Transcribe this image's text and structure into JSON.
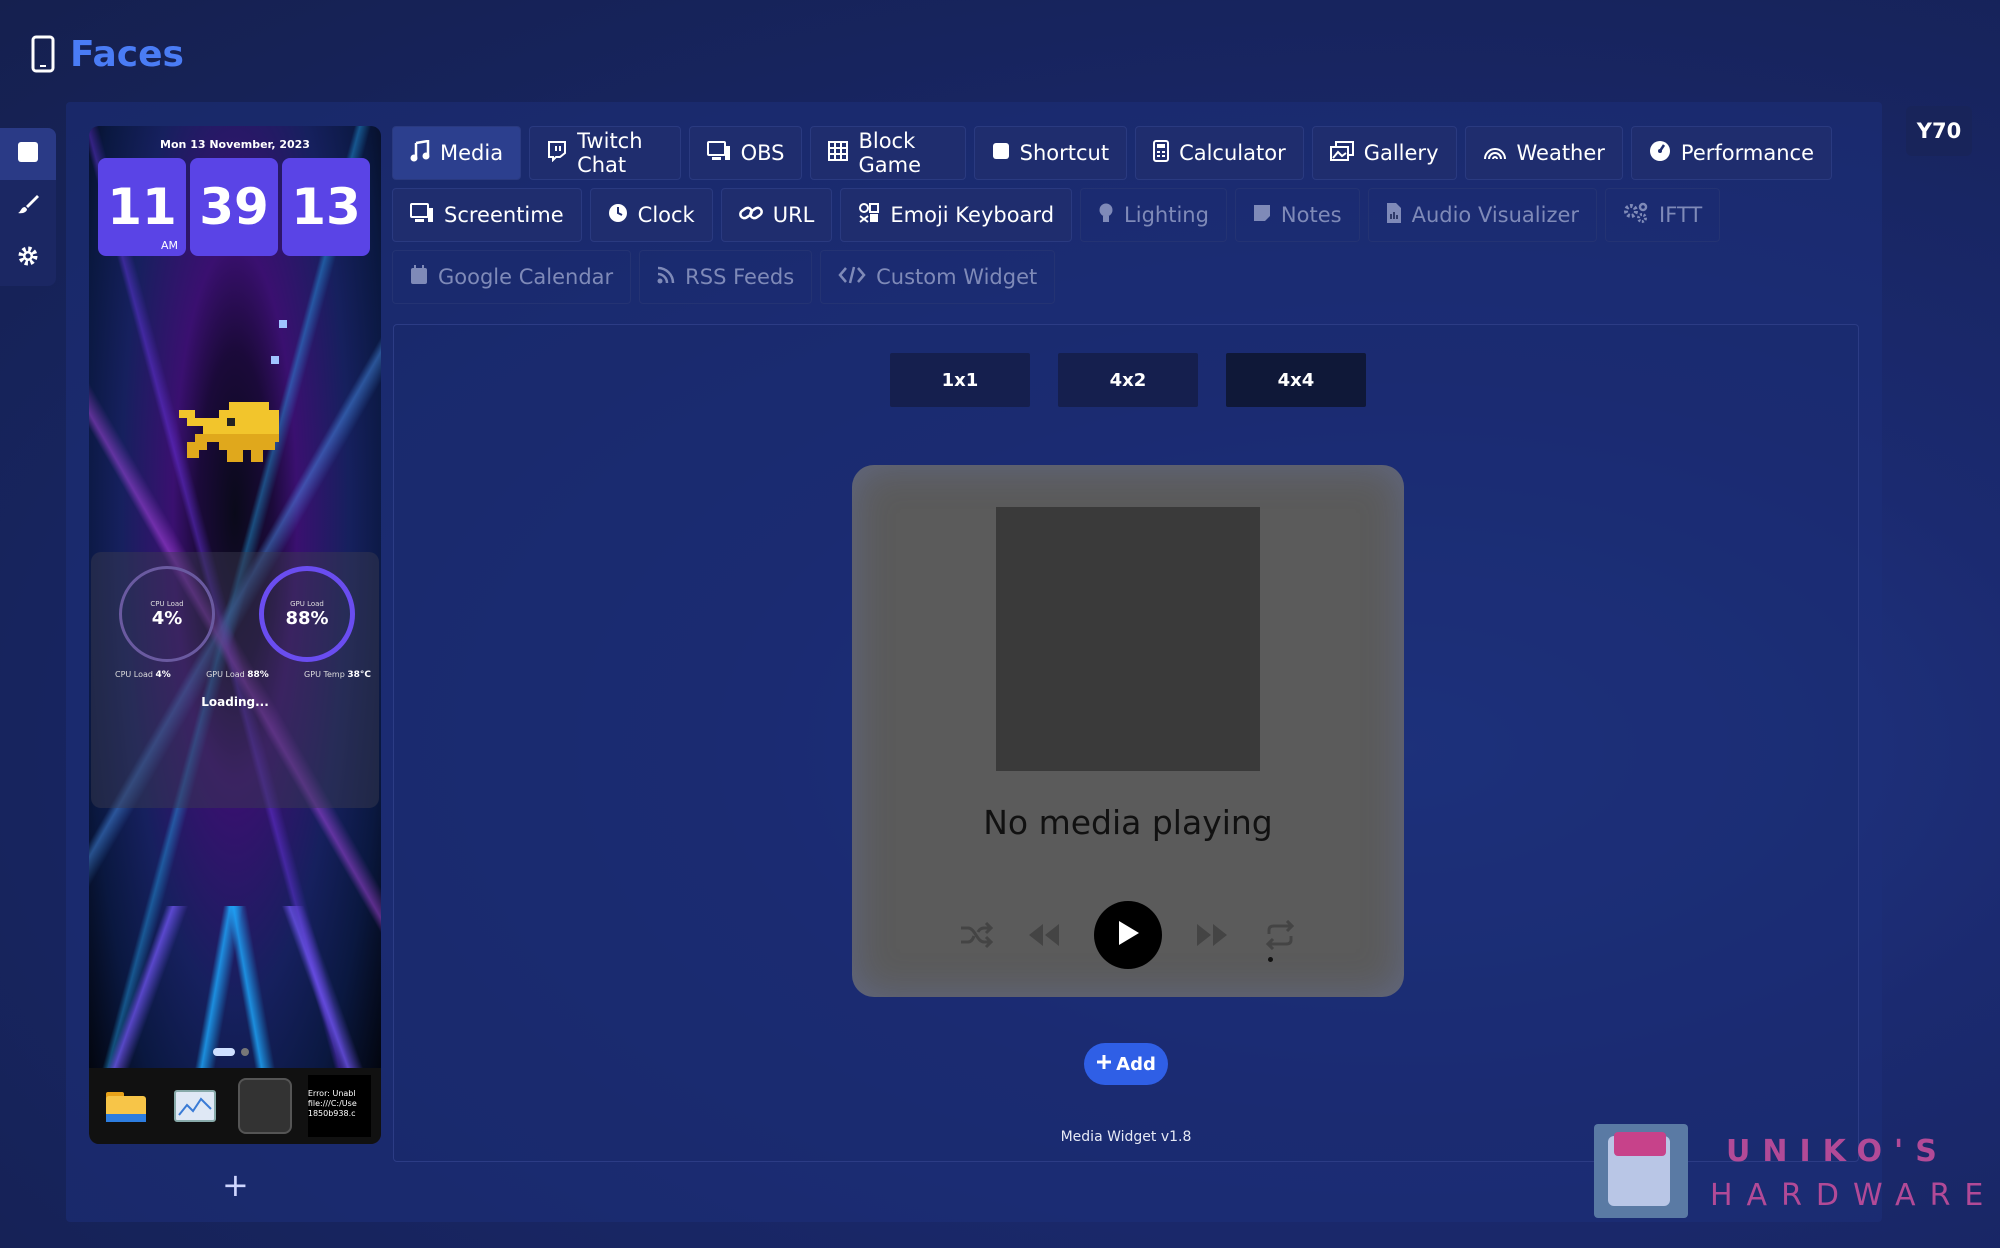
{
  "app": {
    "title": "Faces",
    "device": "Y70"
  },
  "side_tools": [
    {
      "name": "square-tool",
      "icon": "square-icon"
    },
    {
      "name": "brush-tool",
      "icon": "brush-icon"
    },
    {
      "name": "settings-tool",
      "icon": "gear-icon"
    }
  ],
  "preview": {
    "date": "Mon 13 November, 2023",
    "time": {
      "hour": "11",
      "minute": "39",
      "second": "13",
      "ampm": "AM"
    },
    "gauges": [
      {
        "label": "CPU Load",
        "value": "4%"
      },
      {
        "label": "GPU Load",
        "value": "88%"
      }
    ],
    "stats": [
      {
        "label": "CPU Load",
        "value": "4%"
      },
      {
        "label": "GPU Load",
        "value": "88%"
      },
      {
        "label": "GPU Temp",
        "value": "38°C"
      }
    ],
    "loading": "Loading...",
    "dock_error": "Error: Unabl file:///C:/Use 1850b938.c",
    "add_label": "+"
  },
  "tabs": {
    "row1": [
      {
        "label": "Media",
        "icon": "music-icon",
        "state": "active"
      },
      {
        "label": "Twitch Chat",
        "icon": "twitch-icon",
        "state": "enabled"
      },
      {
        "label": "OBS",
        "icon": "monitor-icon",
        "state": "enabled"
      },
      {
        "label": "Block Game",
        "icon": "grid-icon",
        "state": "enabled"
      },
      {
        "label": "Shortcut",
        "icon": "square-icon",
        "state": "enabled"
      },
      {
        "label": "Calculator",
        "icon": "calculator-icon",
        "state": "enabled"
      },
      {
        "label": "Gallery",
        "icon": "images-icon",
        "state": "enabled"
      },
      {
        "label": "Weather",
        "icon": "rainbow-icon",
        "state": "enabled"
      },
      {
        "label": "Performance",
        "icon": "gauge-icon",
        "state": "enabled"
      }
    ],
    "row2": [
      {
        "label": "Screentime",
        "icon": "monitor-icon",
        "state": "enabled"
      },
      {
        "label": "Clock",
        "icon": "clock-icon",
        "state": "enabled"
      },
      {
        "label": "URL",
        "icon": "link-icon",
        "state": "enabled"
      },
      {
        "label": "Emoji Keyboard",
        "icon": "emoji-icon",
        "state": "enabled"
      },
      {
        "label": "Lighting",
        "icon": "bulb-icon",
        "state": "disabled"
      },
      {
        "label": "Notes",
        "icon": "note-icon",
        "state": "disabled"
      },
      {
        "label": "Audio Visualizer",
        "icon": "audio-file-icon",
        "state": "disabled"
      },
      {
        "label": "IFTT",
        "icon": "gears-icon",
        "state": "disabled"
      }
    ],
    "row3": [
      {
        "label": "Google Calendar",
        "icon": "calendar-icon",
        "state": "disabled"
      },
      {
        "label": "RSS Feeds",
        "icon": "rss-icon",
        "state": "disabled"
      },
      {
        "label": "Custom Widget",
        "icon": "code-icon",
        "state": "disabled"
      }
    ]
  },
  "sizes": [
    {
      "label": "1x1",
      "selected": false
    },
    {
      "label": "4x2",
      "selected": false
    },
    {
      "label": "4x4",
      "selected": true
    }
  ],
  "media": {
    "status": "No media playing"
  },
  "actions": {
    "add_label": "Add"
  },
  "footer": {
    "version": "Media Widget v1.8"
  },
  "watermark": {
    "line1": "UNIKO'S",
    "line2": "HARDWARE"
  },
  "colors": {
    "accent": "#4a7cf5",
    "add_button": "#2f5fe6",
    "clock_digit": "#5a44e6",
    "card": "#5b5b5b"
  }
}
